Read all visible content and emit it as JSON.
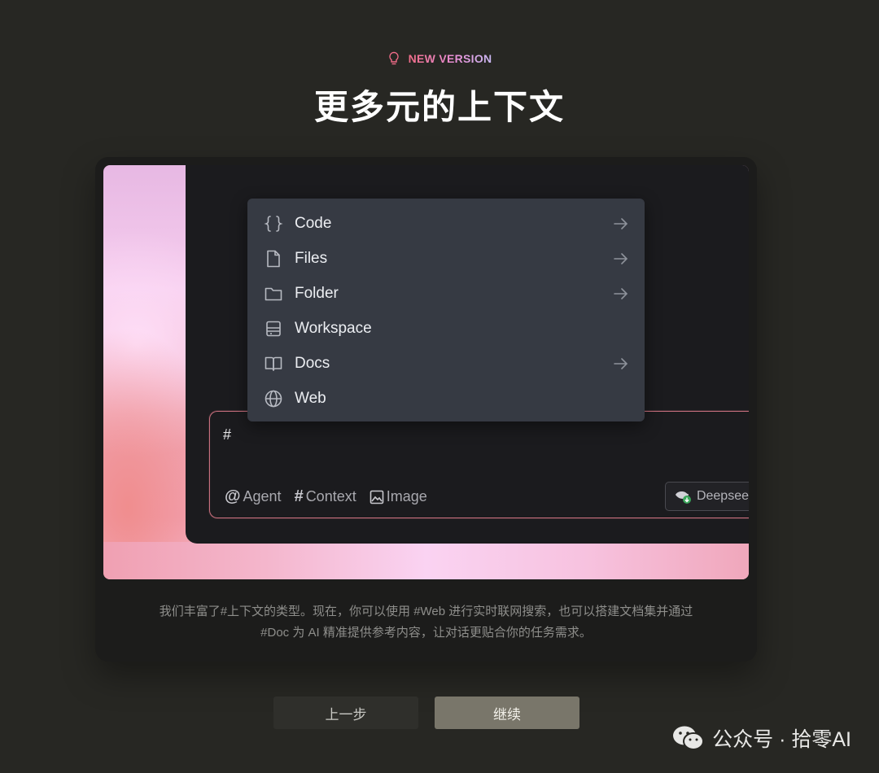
{
  "header": {
    "badge": "NEW VERSION",
    "badge_icon": "lightbulb-icon",
    "title": "更多元的上下文"
  },
  "menu": {
    "items": [
      {
        "label": "Code",
        "icon": "braces-icon",
        "has_arrow": true
      },
      {
        "label": "Files",
        "icon": "file-icon",
        "has_arrow": true
      },
      {
        "label": "Folder",
        "icon": "folder-icon",
        "has_arrow": true
      },
      {
        "label": "Workspace",
        "icon": "workspace-icon",
        "has_arrow": false
      },
      {
        "label": "Docs",
        "icon": "book-icon",
        "has_arrow": true
      },
      {
        "label": "Web",
        "icon": "globe-icon",
        "has_arrow": false
      }
    ]
  },
  "chat": {
    "input_value": "#",
    "agent_label": "Agent",
    "context_label": "Context",
    "image_label": "Image",
    "model_label": "Deepseek"
  },
  "caption": {
    "line1": "我们丰富了#上下文的类型。现在，你可以使用 #Web 进行实时联网搜索，也可以搭建文档集并通过",
    "line2": "#Doc 为 AI 精准提供参考内容，让对话更贴合你的任务需求。"
  },
  "buttons": {
    "prev": "上一步",
    "next": "继续"
  },
  "watermark": {
    "text": "公众号 · 拾零AI"
  },
  "colors": {
    "background": "#272723",
    "card": "#1c1c1b",
    "menu": "#363a43",
    "accent_pink": "#f06c88",
    "next_button": "#79766a"
  }
}
